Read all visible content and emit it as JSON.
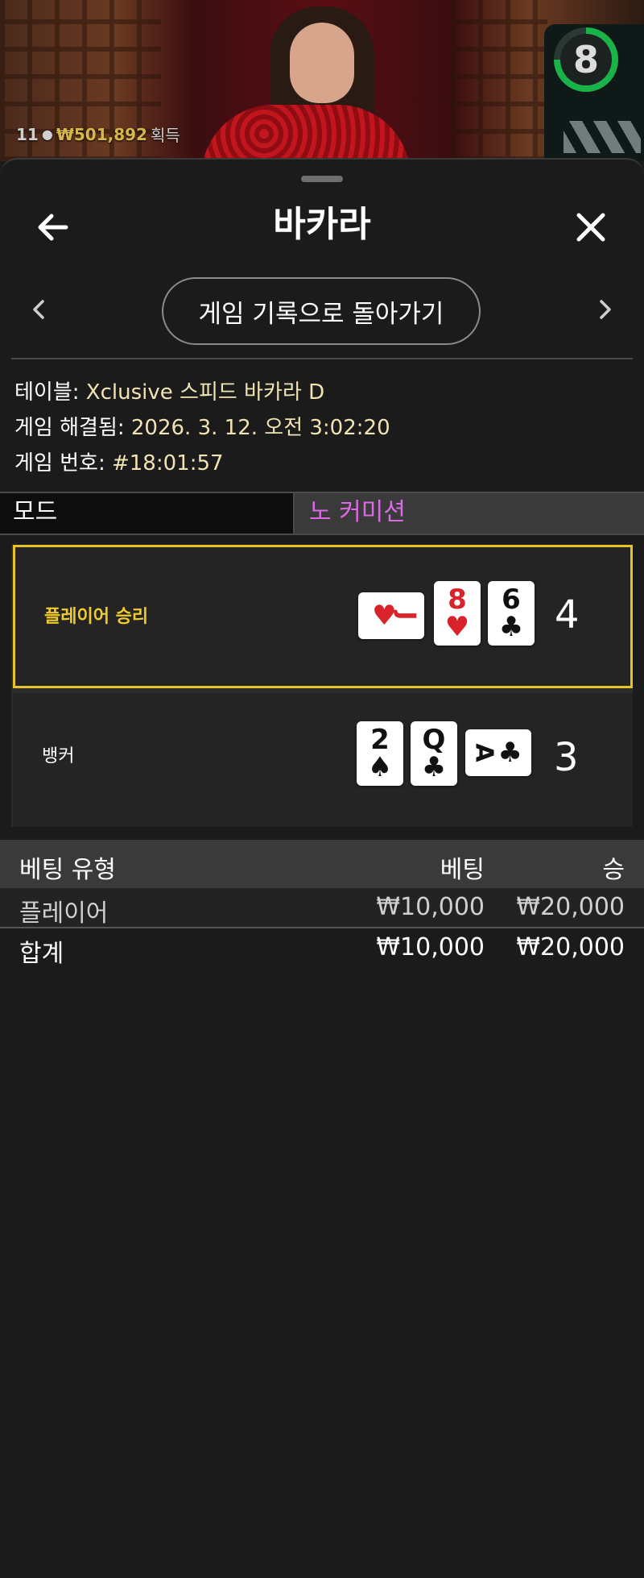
{
  "video": {
    "timer_value": "8",
    "winners_count": "11",
    "winners_amount": "₩501,892",
    "winners_label": "획득"
  },
  "header": {
    "title": "바카라"
  },
  "nav": {
    "return_label": "게임 기록으로 돌아가기"
  },
  "info": {
    "table_label": "테이블: ",
    "table_value": "Xclusive 스피드 바카라 D",
    "resolved_label": "게임 해결됨: ",
    "resolved_value": "2026. 3. 12. 오전 3:02:20",
    "game_no_label": "게임 번호: ",
    "game_no_value": "#18:01:57"
  },
  "mode": {
    "label": "모드",
    "value": "노 커미션"
  },
  "result": {
    "player": {
      "label": "플레이어 승리",
      "score": "4",
      "cards": [
        {
          "rank": "J",
          "suit": "♥",
          "color": "#d9232a",
          "orientation": "sideways"
        },
        {
          "rank": "8",
          "suit": "♥",
          "color": "#d9232a",
          "orientation": "upright"
        },
        {
          "rank": "6",
          "suit": "♣",
          "color": "#111111",
          "orientation": "upright"
        }
      ]
    },
    "banker": {
      "label": "뱅커",
      "score": "3",
      "cards": [
        {
          "rank": "2",
          "suit": "♠",
          "color": "#111111",
          "orientation": "upright"
        },
        {
          "rank": "Q",
          "suit": "♣",
          "color": "#111111",
          "orientation": "upright"
        },
        {
          "rank": "A",
          "suit": "♣",
          "color": "#111111",
          "orientation": "sideways"
        }
      ]
    },
    "highlight_color": "#e6c229"
  },
  "bets": {
    "headers": [
      "베팅 유형",
      "베팅",
      "승"
    ],
    "rows": [
      {
        "type": "플레이어",
        "bet": "₩10,000",
        "win": "₩20,000"
      }
    ],
    "total": {
      "type": "합계",
      "bet": "₩10,000",
      "win": "₩20,000"
    }
  },
  "icons": {
    "back": "arrow-left-icon",
    "close": "close-icon",
    "prev": "chevron-left-icon",
    "next": "chevron-right-icon"
  },
  "colors": {
    "sheet_bg": "#1b1b1b",
    "mode_value": "#d96ae3",
    "info_value": "#f1e3b3",
    "timer_ring": "#19b34a"
  }
}
